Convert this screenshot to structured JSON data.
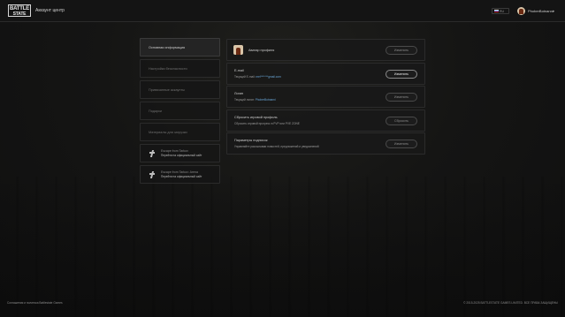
{
  "header": {
    "logo_line1": "BATTLE",
    "logo_line2": "STATE",
    "app_title": "Аккаунт центр",
    "language": "RU",
    "username": "PhoberBotnanni",
    "caret": "▾"
  },
  "sidebar": {
    "items": [
      {
        "label": "Основная информация",
        "active": true
      },
      {
        "label": "Настройки безопасности",
        "active": false
      },
      {
        "label": "Привязанные аккаунты",
        "active": false
      },
      {
        "label": "Подарки",
        "active": false
      },
      {
        "label": "Материалы для загрузки",
        "active": false
      }
    ],
    "games": [
      {
        "title": "Escape from Tarkov",
        "subtitle": "Перейти на официальный сайт",
        "icon": "tarkov-logo-icon"
      },
      {
        "title": "Escape from Tarkov: Arena",
        "subtitle": "Перейти на официальный сайт",
        "icon": "arena-logo-icon"
      }
    ]
  },
  "main": {
    "avatar_row": {
      "title": "Аватар профиля",
      "button": "Изменить"
    },
    "email_row": {
      "title": "E-mail",
      "sub_prefix": "Текущий E-mail: ",
      "sub_value": "mel*******gmail.com",
      "button": "Изменить"
    },
    "login_row": {
      "title": "Логин",
      "sub_prefix": "Текущий логин: ",
      "sub_value": "PhoberBotnanni",
      "button": "Изменить"
    },
    "reset_row": {
      "title": "Сбросить игровой профиль",
      "sub": "Сбросить игровой прогресс в PVP или PVE ZONE",
      "button": "Сбросить"
    },
    "sub_row": {
      "title": "Параметры подписок",
      "sub": "Управляйте рассылками новостей, предложений и уведомлений",
      "button": "Изменить"
    }
  },
  "footer": {
    "left": "Соглашения и политика Battlestate Games",
    "right": "© 2015-2025 BATTLESTATE GAMES LIMITED. ВСЕ ПРАВА ЗАЩИЩЕНЫ"
  }
}
